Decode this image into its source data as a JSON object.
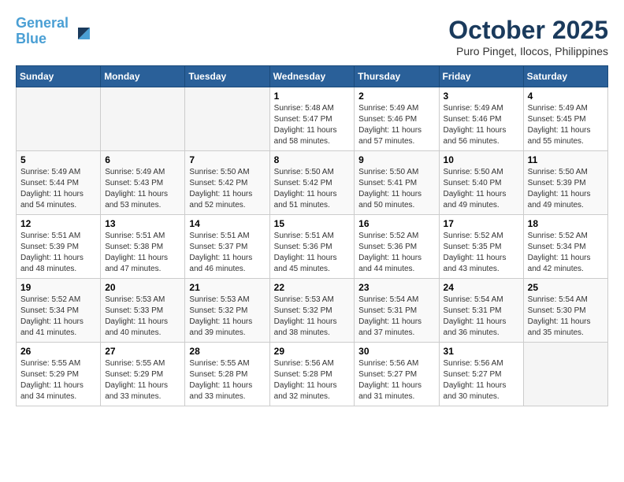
{
  "header": {
    "logo_line1": "General",
    "logo_line2": "Blue",
    "month": "October 2025",
    "location": "Puro Pinget, Ilocos, Philippines"
  },
  "weekdays": [
    "Sunday",
    "Monday",
    "Tuesday",
    "Wednesday",
    "Thursday",
    "Friday",
    "Saturday"
  ],
  "weeks": [
    [
      {
        "day": "",
        "sunrise": "",
        "sunset": "",
        "daylight": ""
      },
      {
        "day": "",
        "sunrise": "",
        "sunset": "",
        "daylight": ""
      },
      {
        "day": "",
        "sunrise": "",
        "sunset": "",
        "daylight": ""
      },
      {
        "day": "1",
        "sunrise": "Sunrise: 5:48 AM",
        "sunset": "Sunset: 5:47 PM",
        "daylight": "Daylight: 11 hours and 58 minutes."
      },
      {
        "day": "2",
        "sunrise": "Sunrise: 5:49 AM",
        "sunset": "Sunset: 5:46 PM",
        "daylight": "Daylight: 11 hours and 57 minutes."
      },
      {
        "day": "3",
        "sunrise": "Sunrise: 5:49 AM",
        "sunset": "Sunset: 5:46 PM",
        "daylight": "Daylight: 11 hours and 56 minutes."
      },
      {
        "day": "4",
        "sunrise": "Sunrise: 5:49 AM",
        "sunset": "Sunset: 5:45 PM",
        "daylight": "Daylight: 11 hours and 55 minutes."
      }
    ],
    [
      {
        "day": "5",
        "sunrise": "Sunrise: 5:49 AM",
        "sunset": "Sunset: 5:44 PM",
        "daylight": "Daylight: 11 hours and 54 minutes."
      },
      {
        "day": "6",
        "sunrise": "Sunrise: 5:49 AM",
        "sunset": "Sunset: 5:43 PM",
        "daylight": "Daylight: 11 hours and 53 minutes."
      },
      {
        "day": "7",
        "sunrise": "Sunrise: 5:50 AM",
        "sunset": "Sunset: 5:42 PM",
        "daylight": "Daylight: 11 hours and 52 minutes."
      },
      {
        "day": "8",
        "sunrise": "Sunrise: 5:50 AM",
        "sunset": "Sunset: 5:42 PM",
        "daylight": "Daylight: 11 hours and 51 minutes."
      },
      {
        "day": "9",
        "sunrise": "Sunrise: 5:50 AM",
        "sunset": "Sunset: 5:41 PM",
        "daylight": "Daylight: 11 hours and 50 minutes."
      },
      {
        "day": "10",
        "sunrise": "Sunrise: 5:50 AM",
        "sunset": "Sunset: 5:40 PM",
        "daylight": "Daylight: 11 hours and 49 minutes."
      },
      {
        "day": "11",
        "sunrise": "Sunrise: 5:50 AM",
        "sunset": "Sunset: 5:39 PM",
        "daylight": "Daylight: 11 hours and 49 minutes."
      }
    ],
    [
      {
        "day": "12",
        "sunrise": "Sunrise: 5:51 AM",
        "sunset": "Sunset: 5:39 PM",
        "daylight": "Daylight: 11 hours and 48 minutes."
      },
      {
        "day": "13",
        "sunrise": "Sunrise: 5:51 AM",
        "sunset": "Sunset: 5:38 PM",
        "daylight": "Daylight: 11 hours and 47 minutes."
      },
      {
        "day": "14",
        "sunrise": "Sunrise: 5:51 AM",
        "sunset": "Sunset: 5:37 PM",
        "daylight": "Daylight: 11 hours and 46 minutes."
      },
      {
        "day": "15",
        "sunrise": "Sunrise: 5:51 AM",
        "sunset": "Sunset: 5:36 PM",
        "daylight": "Daylight: 11 hours and 45 minutes."
      },
      {
        "day": "16",
        "sunrise": "Sunrise: 5:52 AM",
        "sunset": "Sunset: 5:36 PM",
        "daylight": "Daylight: 11 hours and 44 minutes."
      },
      {
        "day": "17",
        "sunrise": "Sunrise: 5:52 AM",
        "sunset": "Sunset: 5:35 PM",
        "daylight": "Daylight: 11 hours and 43 minutes."
      },
      {
        "day": "18",
        "sunrise": "Sunrise: 5:52 AM",
        "sunset": "Sunset: 5:34 PM",
        "daylight": "Daylight: 11 hours and 42 minutes."
      }
    ],
    [
      {
        "day": "19",
        "sunrise": "Sunrise: 5:52 AM",
        "sunset": "Sunset: 5:34 PM",
        "daylight": "Daylight: 11 hours and 41 minutes."
      },
      {
        "day": "20",
        "sunrise": "Sunrise: 5:53 AM",
        "sunset": "Sunset: 5:33 PM",
        "daylight": "Daylight: 11 hours and 40 minutes."
      },
      {
        "day": "21",
        "sunrise": "Sunrise: 5:53 AM",
        "sunset": "Sunset: 5:32 PM",
        "daylight": "Daylight: 11 hours and 39 minutes."
      },
      {
        "day": "22",
        "sunrise": "Sunrise: 5:53 AM",
        "sunset": "Sunset: 5:32 PM",
        "daylight": "Daylight: 11 hours and 38 minutes."
      },
      {
        "day": "23",
        "sunrise": "Sunrise: 5:54 AM",
        "sunset": "Sunset: 5:31 PM",
        "daylight": "Daylight: 11 hours and 37 minutes."
      },
      {
        "day": "24",
        "sunrise": "Sunrise: 5:54 AM",
        "sunset": "Sunset: 5:31 PM",
        "daylight": "Daylight: 11 hours and 36 minutes."
      },
      {
        "day": "25",
        "sunrise": "Sunrise: 5:54 AM",
        "sunset": "Sunset: 5:30 PM",
        "daylight": "Daylight: 11 hours and 35 minutes."
      }
    ],
    [
      {
        "day": "26",
        "sunrise": "Sunrise: 5:55 AM",
        "sunset": "Sunset: 5:29 PM",
        "daylight": "Daylight: 11 hours and 34 minutes."
      },
      {
        "day": "27",
        "sunrise": "Sunrise: 5:55 AM",
        "sunset": "Sunset: 5:29 PM",
        "daylight": "Daylight: 11 hours and 33 minutes."
      },
      {
        "day": "28",
        "sunrise": "Sunrise: 5:55 AM",
        "sunset": "Sunset: 5:28 PM",
        "daylight": "Daylight: 11 hours and 33 minutes."
      },
      {
        "day": "29",
        "sunrise": "Sunrise: 5:56 AM",
        "sunset": "Sunset: 5:28 PM",
        "daylight": "Daylight: 11 hours and 32 minutes."
      },
      {
        "day": "30",
        "sunrise": "Sunrise: 5:56 AM",
        "sunset": "Sunset: 5:27 PM",
        "daylight": "Daylight: 11 hours and 31 minutes."
      },
      {
        "day": "31",
        "sunrise": "Sunrise: 5:56 AM",
        "sunset": "Sunset: 5:27 PM",
        "daylight": "Daylight: 11 hours and 30 minutes."
      },
      {
        "day": "",
        "sunrise": "",
        "sunset": "",
        "daylight": ""
      }
    ]
  ]
}
